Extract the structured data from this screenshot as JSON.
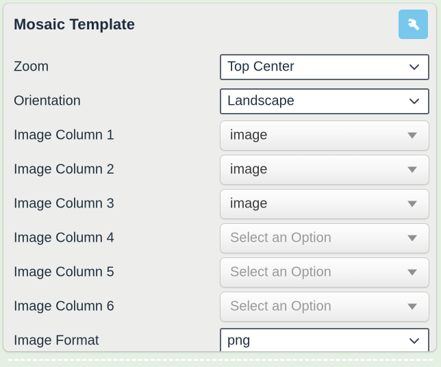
{
  "panel": {
    "title": "Mosaic Template",
    "settings_icon": "wrench-icon",
    "accent_color": "#77c8ec",
    "background_color": "#edeeec",
    "page_background_color": "#e4f0e2",
    "label_color": "#22303f"
  },
  "rows": [
    {
      "label": "Zoom",
      "control": "native-select",
      "value": "Top Center",
      "icon": "chevron-down-icon",
      "state": "enabled",
      "name": "zoom"
    },
    {
      "label": "Orientation",
      "control": "native-select",
      "value": "Landscape",
      "icon": "chevron-down-icon",
      "state": "enabled",
      "name": "orientation"
    },
    {
      "label": "Image Column 1",
      "control": "custom-select",
      "value": "image",
      "icon": "triangle-down-icon",
      "state": "selected",
      "name": "image-column-1"
    },
    {
      "label": "Image Column 2",
      "control": "custom-select",
      "value": "image",
      "icon": "triangle-down-icon",
      "state": "selected",
      "name": "image-column-2"
    },
    {
      "label": "Image Column 3",
      "control": "custom-select",
      "value": "image",
      "icon": "triangle-down-icon",
      "state": "selected",
      "name": "image-column-3"
    },
    {
      "label": "Image Column 4",
      "control": "custom-select",
      "value": "Select an Option",
      "icon": "triangle-down-icon",
      "state": "placeholder",
      "name": "image-column-4"
    },
    {
      "label": "Image Column 5",
      "control": "custom-select",
      "value": "Select an Option",
      "icon": "triangle-down-icon",
      "state": "placeholder",
      "name": "image-column-5"
    },
    {
      "label": "Image Column 6",
      "control": "custom-select",
      "value": "Select an Option",
      "icon": "triangle-down-icon",
      "state": "placeholder",
      "name": "image-column-6"
    },
    {
      "label": "Image Format",
      "control": "native-select",
      "value": "png",
      "icon": "chevron-down-icon",
      "state": "enabled",
      "name": "image-format"
    }
  ]
}
